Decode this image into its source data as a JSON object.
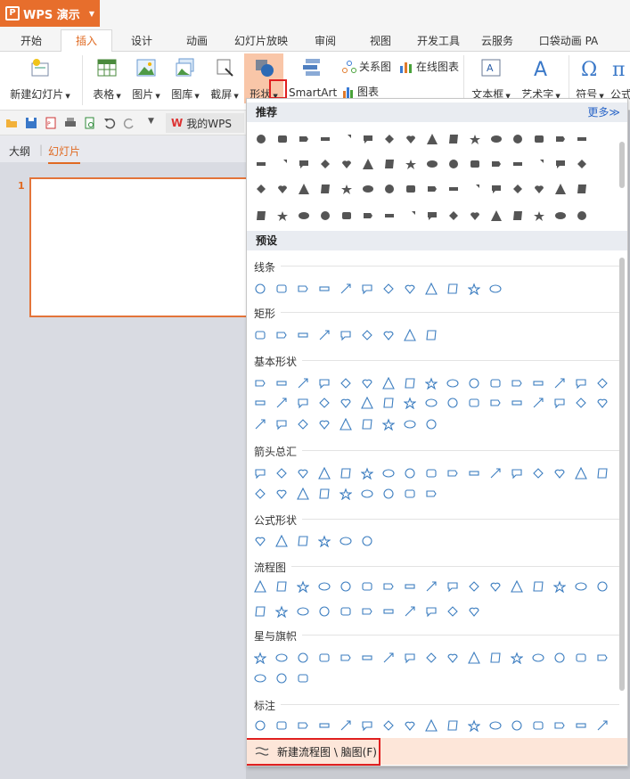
{
  "app": {
    "name": "WPS 演示"
  },
  "menu_tabs": [
    "开始",
    "插入",
    "设计",
    "动画",
    "幻灯片放映",
    "审阅",
    "视图",
    "开发工具",
    "云服务",
    "口袋动画 PA"
  ],
  "active_tab": "插入",
  "ribbon": {
    "new_slide": "新建幻灯片",
    "table": "表格",
    "picture": "图片",
    "gallery": "图库",
    "screenshot": "截屏",
    "shapes": "形状",
    "smartart": "SmartArt",
    "relation": "关系图",
    "online_chart": "在线图表",
    "chart": "图表",
    "textbox": "文本框",
    "wordart": "艺术字",
    "symbol": "符号",
    "formula": "公式"
  },
  "quick_access": {
    "my_wps": "我的WPS"
  },
  "left_pane": {
    "tab_outline": "大纲",
    "tab_slides": "幻灯片",
    "slide_number": "1"
  },
  "dropdown": {
    "recommended": "推荐",
    "more": "更多≫",
    "presets": "预设",
    "groups": {
      "lines": "线条",
      "rect": "矩形",
      "basic": "基本形状",
      "arrows": "箭头总汇",
      "equation": "公式形状",
      "flowchart": "流程图",
      "stars": "星与旗帜",
      "callouts": "标注"
    },
    "new_flowchart": "新建流程图 \\ 脑图(F)"
  },
  "colors": {
    "accent": "#e76e2c",
    "shape_stroke": "#3d7ec0",
    "highlight": "#e02020"
  }
}
